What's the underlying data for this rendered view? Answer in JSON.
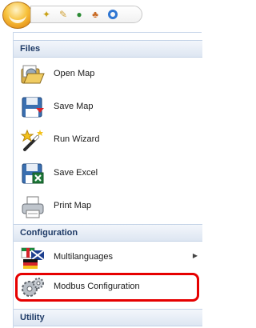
{
  "quick_access": {
    "icons": [
      "wand-icon",
      "tools-icon",
      "user-icon",
      "user-settings-icon",
      "refresh-icon"
    ]
  },
  "sections": {
    "files": "Files",
    "configuration": "Configuration",
    "utility": "Utility"
  },
  "items": {
    "open_map": "Open Map",
    "save_map": "Save Map",
    "run_wizard": "Run Wizard",
    "save_excel": "Save Excel",
    "print_map": "Print Map",
    "multilanguages": "Multilanguages",
    "modbus_configuration": "Modbus Configuration"
  },
  "colors": {
    "section_text": "#1e3a66",
    "highlight": "#e60000",
    "orb": "#f7c23c"
  }
}
